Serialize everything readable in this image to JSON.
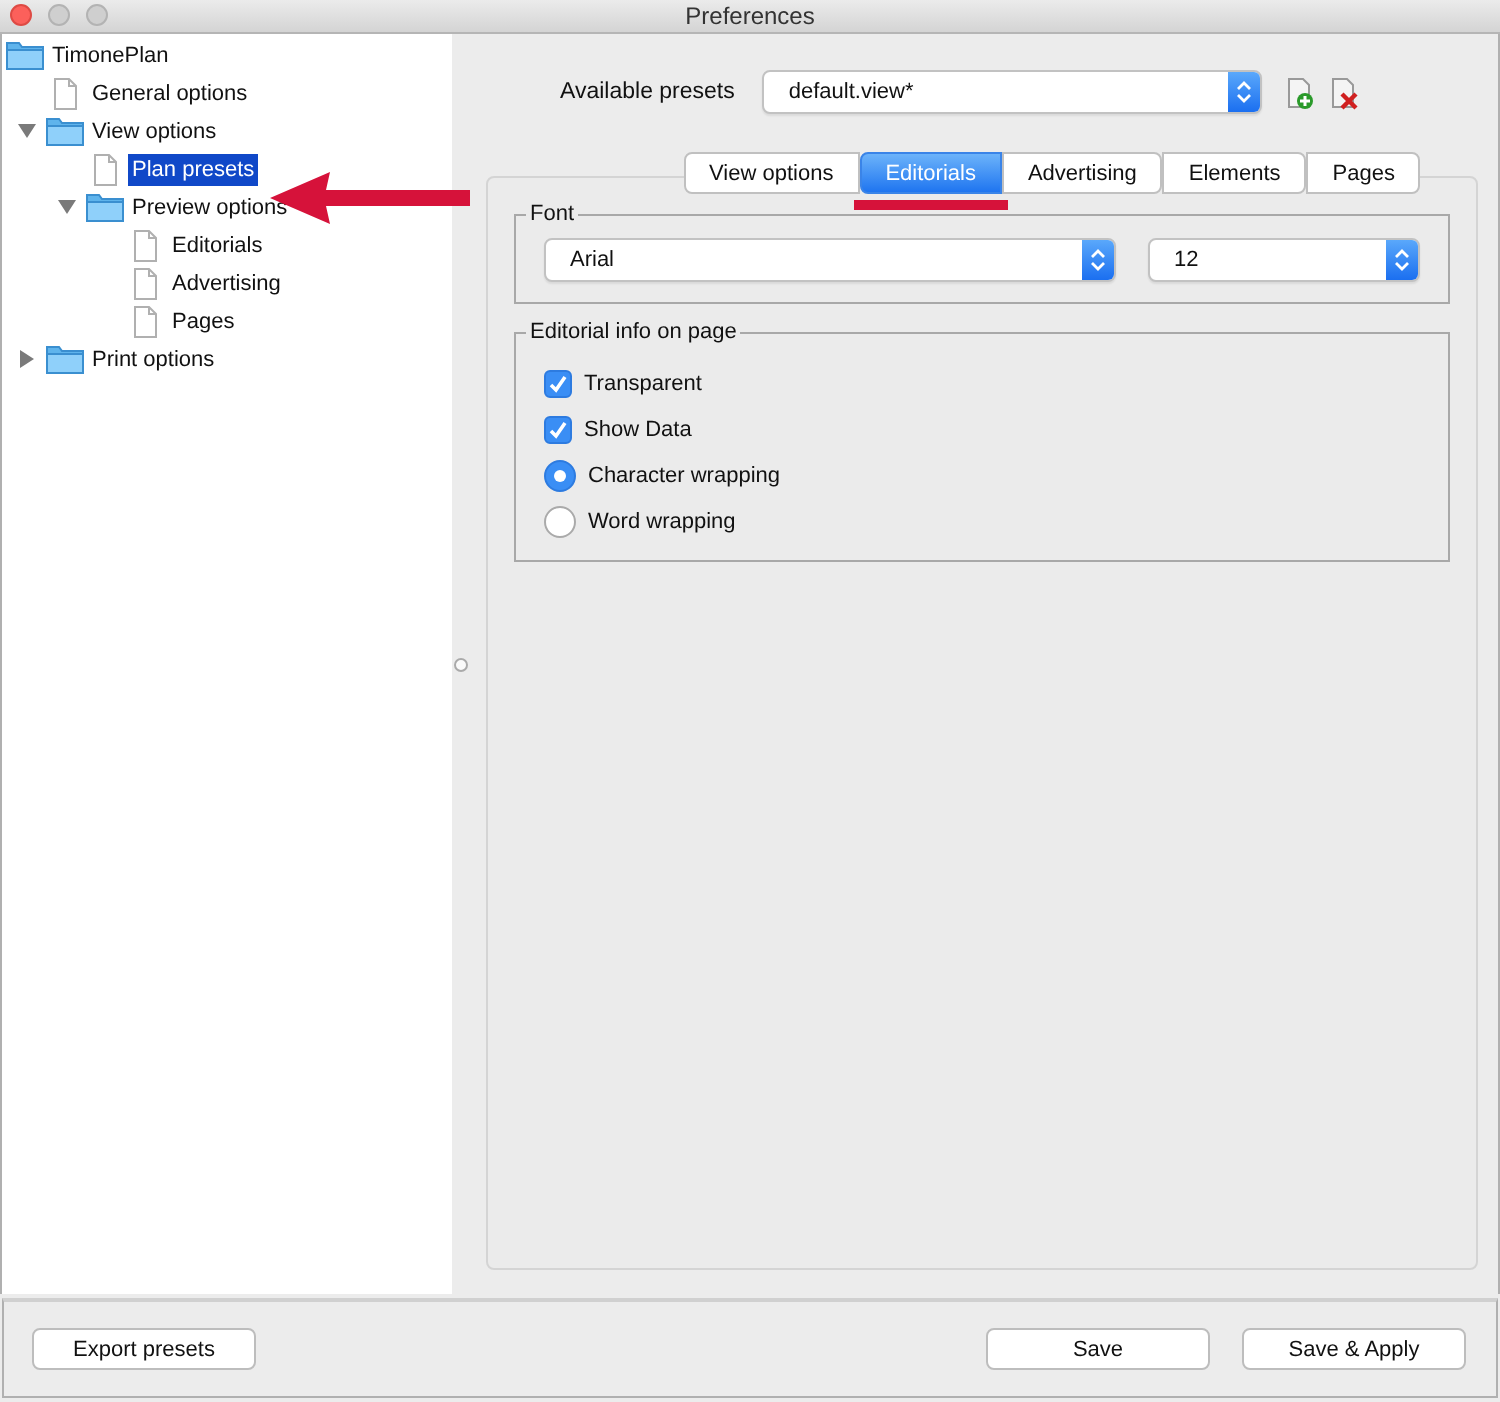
{
  "window": {
    "title": "Preferences"
  },
  "tree": [
    {
      "label": "TimonePlan",
      "kind": "folder",
      "selected": false,
      "children": [
        {
          "label": "General options",
          "kind": "page",
          "selected": false
        },
        {
          "label": "View options",
          "kind": "folder",
          "expanded": true,
          "selected": false,
          "children": [
            {
              "label": "Plan presets",
              "kind": "page",
              "selected": true
            },
            {
              "label": "Preview options",
              "kind": "folder",
              "expanded": true,
              "selected": false,
              "children": [
                {
                  "label": "Editorials",
                  "kind": "page",
                  "selected": false
                },
                {
                  "label": "Advertising",
                  "kind": "page",
                  "selected": false
                },
                {
                  "label": "Pages",
                  "kind": "page",
                  "selected": false
                }
              ]
            }
          ]
        },
        {
          "label": "Print options",
          "kind": "folder",
          "expanded": false,
          "selected": false
        }
      ]
    }
  ],
  "presets": {
    "label": "Available presets",
    "value": "default.view*"
  },
  "tabs": [
    {
      "label": "View options",
      "selected": false
    },
    {
      "label": "Editorials",
      "selected": true
    },
    {
      "label": "Advertising",
      "selected": false
    },
    {
      "label": "Elements",
      "selected": false
    },
    {
      "label": "Pages",
      "selected": false
    }
  ],
  "font_group": {
    "title": "Font",
    "family": "Arial",
    "size": "12"
  },
  "editorial_group": {
    "title": "Editorial info on page",
    "options": [
      {
        "kind": "checkbox",
        "label": "Transparent",
        "checked": true
      },
      {
        "kind": "checkbox",
        "label": "Show Data",
        "checked": true
      },
      {
        "kind": "radio",
        "label": "Character wrapping",
        "checked": true
      },
      {
        "kind": "radio",
        "label": "Word wrapping",
        "checked": false
      }
    ]
  },
  "footer_buttons": [
    "Export presets",
    "Save",
    "Save & Apply"
  ]
}
